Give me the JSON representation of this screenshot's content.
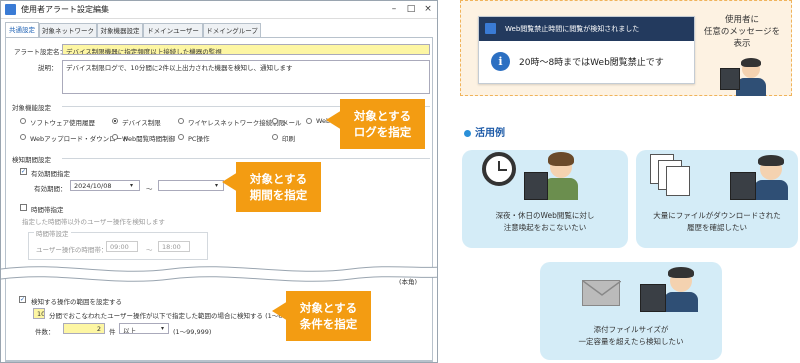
{
  "dialog": {
    "title": "使用者アラート設定編集",
    "tabs": [
      "共通設定",
      "対象ネットワーク設定",
      "対象機器設定",
      "ドメインユーザー設定",
      "ドメイングループ設定"
    ],
    "alert_name_label": "アラート設定名：",
    "alert_name_value": "デバイス制限機器に指定頻度以上接続した機器の監視",
    "description_label": "説明：",
    "description_value": "デバイス制限ログで、10分間に2件以上出力された機器を検知し、通知します",
    "target_function_label": "対象機能設定",
    "functions": [
      {
        "label": "ソフトウェア使用履歴",
        "selected": false
      },
      {
        "label": "デバイス制限",
        "selected": true
      },
      {
        "label": "ワイヤレスネットワーク接続制限",
        "selected": false
      },
      {
        "label": "メール",
        "selected": false
      },
      {
        "label": "Web",
        "selected": false
      },
      {
        "label": "Webアップロード・ダウンロード",
        "selected": false
      },
      {
        "label": "Web閲覧時間制御",
        "selected": false
      },
      {
        "label": "PC操作",
        "selected": false
      },
      {
        "label": "印刷",
        "selected": false
      }
    ],
    "period_label": "検知期間設定",
    "period_check_label": "有効期間指定",
    "period_field_label": "有効期間：",
    "period_start": "2024/10/08",
    "period_sep": "～",
    "time_check_label": "時間帯指定",
    "time_desc": "指定した時間帯以外のユーザー操作を検知します",
    "time_group_label": "時間帯設定",
    "time_field_label": "ユーザー操作の時間帯：",
    "time_start": "09:00",
    "time_end": "18:00",
    "partial_label": "(本角)",
    "count_check_label": "検知する操作の範囲を設定する",
    "minutes_value": "10",
    "minutes_text": "分間でおこなわれたユーザー操作が以下で指定した範囲の場合に検知する (1～60)",
    "count_label": "件数：",
    "count_value": "2",
    "count_unit": "件",
    "count_mode": "以上",
    "count_range": "(1～99,999)"
  },
  "callouts": {
    "log": "対象とする\nログを指定",
    "period": "対象とする\n期間を指定",
    "condition": "対象とする\n条件を指定"
  },
  "notification": {
    "header": "Web閲覧禁止時間に閲覧が検知されました",
    "message": "20時～8時まではWeb閲覧禁止です",
    "caption": "使用者に\n任意のメッセージを\n表示"
  },
  "usecases": {
    "title": "活用例",
    "items": [
      "深夜・休日のWeb閲覧に対し\n注意喚起をおこないたい",
      "大量にファイルがダウンロードされた\n履歴を確認したい",
      "添付ファイルサイズが\n一定容量を超えたら検知したい"
    ]
  },
  "colors": {
    "callout": "#f39c12",
    "card": "#d4ecf7",
    "notif_header": "#233a5e",
    "accent": "#1e5ba8"
  }
}
